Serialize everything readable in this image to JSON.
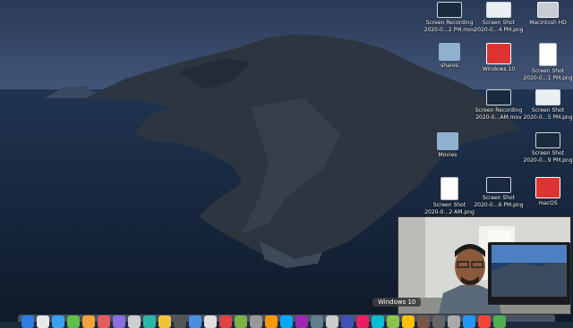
{
  "desktop_icons": [
    {
      "label_1": "Screen Recording",
      "label_2": "2020-0…2 PM.mov",
      "kind": "screen"
    },
    {
      "label_1": "Screen Shot",
      "label_2": "2020-0…4 PM.png",
      "kind": "screen-light"
    },
    {
      "label_1": "Macintosh HD",
      "label_2": "",
      "kind": "hd"
    },
    {
      "label_1": "shares",
      "label_2": "",
      "kind": "folder"
    },
    {
      "label_1": "Windows 10",
      "label_2": "",
      "kind": "parallels"
    },
    {
      "label_1": "Screen Shot",
      "label_2": "2020-0…1 PM.png",
      "kind": "doc"
    },
    {
      "label_1": "Screen Recording",
      "label_2": "2020-0…AM.mov",
      "kind": "screen"
    },
    {
      "label_1": "Screen Shot",
      "label_2": "2020-0…5 PM.png",
      "kind": "screen-light"
    },
    {
      "label_1": "Movies",
      "label_2": "",
      "kind": "folder"
    },
    {
      "label_1": "Screen Shot",
      "label_2": "2020-0…9 PM.png",
      "kind": "screen"
    },
    {
      "label_1": "Screen Shot",
      "label_2": "2020-0…2 AM.png",
      "kind": "doc"
    },
    {
      "label_1": "Screen Shot",
      "label_2": "2020-0…6 PM.png",
      "kind": "screen"
    },
    {
      "label_1": "macOS",
      "label_2": "",
      "kind": "parallels"
    }
  ],
  "dock": {
    "tooltip": "Windows 10",
    "app_colors": [
      "#2e7de1",
      "#e9e9e9",
      "#3aa0f0",
      "#5fbf4a",
      "#f2a23a",
      "#e35d5d",
      "#8a6de0",
      "#cfcfcf",
      "#2ab7a9",
      "#f0c43a",
      "#555",
      "#4a90e2",
      "#e0e0e0",
      "#d44",
      "#7cb342",
      "#999",
      "#ff9800",
      "#03a9f4",
      "#9c27b0",
      "#607d8b",
      "#ccc",
      "#3f51b5",
      "#e91e63",
      "#00bcd4",
      "#8bc34a",
      "#ffc107",
      "#795548",
      "#666",
      "#aaa",
      "#2196f3",
      "#f44336",
      "#4caf50"
    ]
  },
  "webcam": {
    "kind": "video-feed"
  }
}
